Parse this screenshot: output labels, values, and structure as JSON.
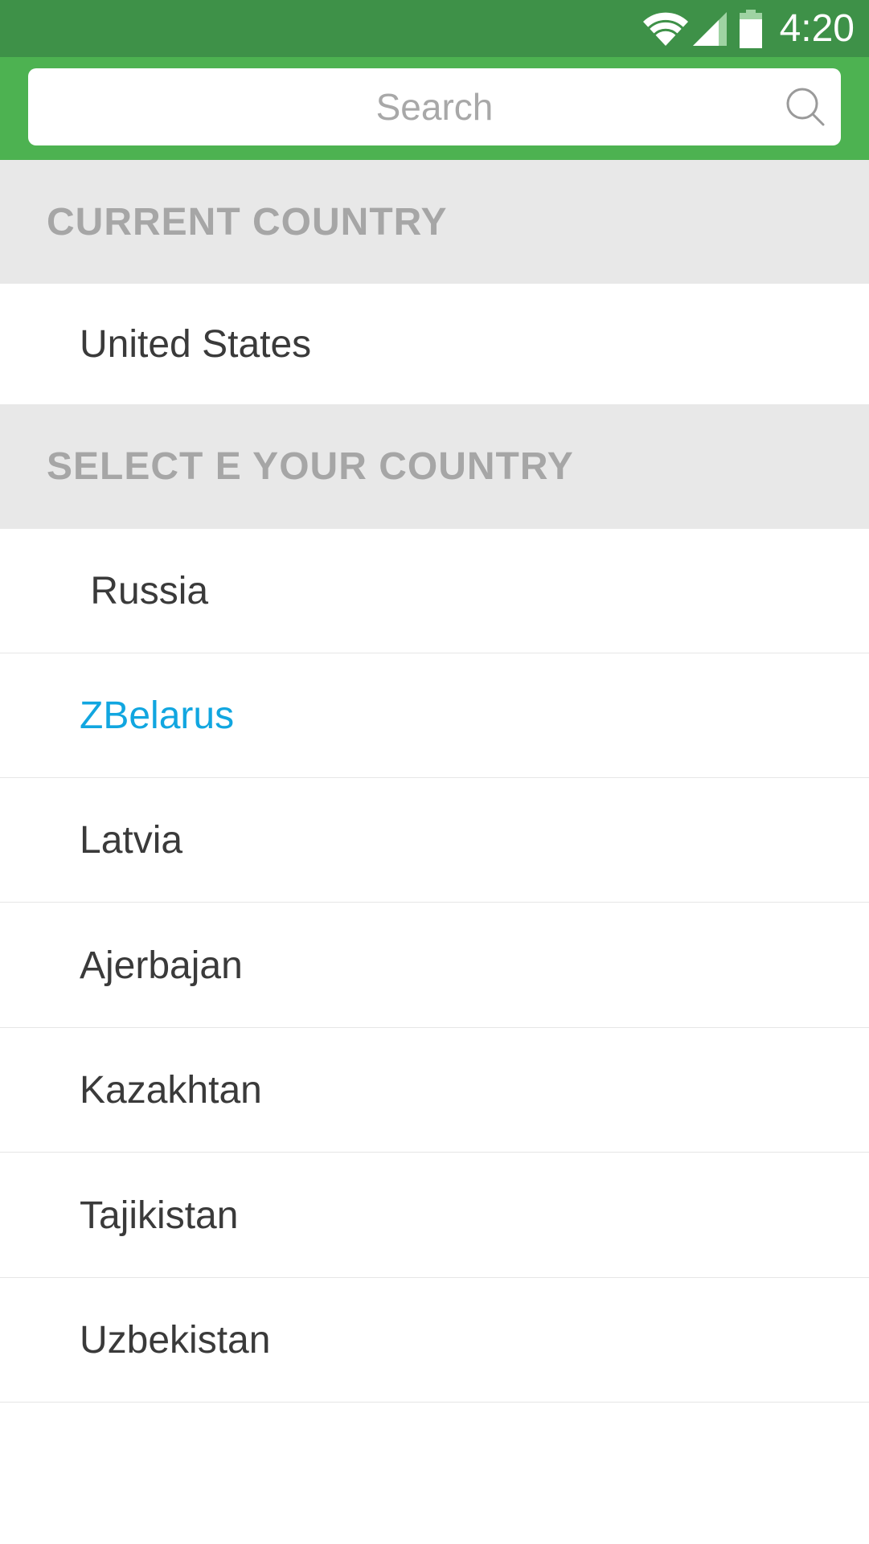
{
  "status_bar": {
    "time": "4:20",
    "icons": [
      "wifi-icon",
      "cellular-signal-icon",
      "battery-icon"
    ],
    "color": "#3e9148"
  },
  "search": {
    "placeholder": "Search",
    "icon": "search-icon",
    "header_color": "#4db251"
  },
  "current_section": {
    "header": "CURRENT COUNTRY",
    "country": "United States"
  },
  "select_section": {
    "header": "SELECT E YOUR COUNTRY",
    "countries": [
      {
        "label": " Russia"
      },
      {
        "label": "ZBelarus",
        "selected": true
      },
      {
        "label": "Latvia"
      },
      {
        "label": "Ajerbajan"
      },
      {
        "label": "Kazakhtan"
      },
      {
        "label": "Tajikistan"
      },
      {
        "label": "Uzbekistan"
      }
    ],
    "selected_color": "#11a6e0"
  }
}
